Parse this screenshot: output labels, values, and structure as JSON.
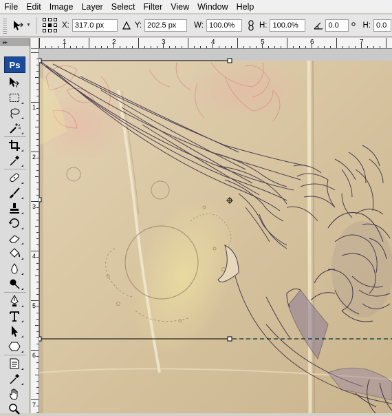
{
  "menu": {
    "items": [
      "File",
      "Edit",
      "Image",
      "Layer",
      "Select",
      "Filter",
      "View",
      "Window",
      "Help"
    ]
  },
  "options": {
    "x_label": "X:",
    "x_value": "317.0 px",
    "y_label": "Y:",
    "y_value": "202.5 px",
    "w_label": "W:",
    "w_value": "100.0%",
    "h_label": "H:",
    "h_value": "100.0%",
    "angle_value": "0.0",
    "h_skew_label": "H:",
    "h_skew_value": "0.0"
  },
  "toolbox": {
    "logo": "Ps",
    "tools": [
      "move-tool-icon",
      "marquee-tool-icon",
      "lasso-tool-icon",
      "magic-wand-tool-icon",
      "crop-tool-icon",
      "eyedropper-tool-icon",
      "healing-brush-tool-icon",
      "brush-tool-icon",
      "clone-stamp-tool-icon",
      "history-brush-tool-icon",
      "eraser-tool-icon",
      "paint-bucket-tool-icon",
      "blur-tool-icon",
      "dodge-tool-icon",
      "pen-tool-icon",
      "type-tool-icon",
      "path-selection-tool-icon",
      "shape-tool-icon",
      "notes-tool-icon",
      "eyedropper-tool-icon-2",
      "hand-tool-icon",
      "zoom-tool-icon"
    ]
  },
  "rulers": {
    "top_numbers": [
      "1",
      "2",
      "3",
      "4",
      "5",
      "6",
      "7"
    ],
    "left_numbers": [
      "1",
      "2",
      "3",
      "4",
      "5",
      "6",
      "7"
    ]
  },
  "colors": {
    "canvas_paper": "#d9c7a3",
    "selection_line": "#000000",
    "ps_blue": "#1a4c9b"
  }
}
